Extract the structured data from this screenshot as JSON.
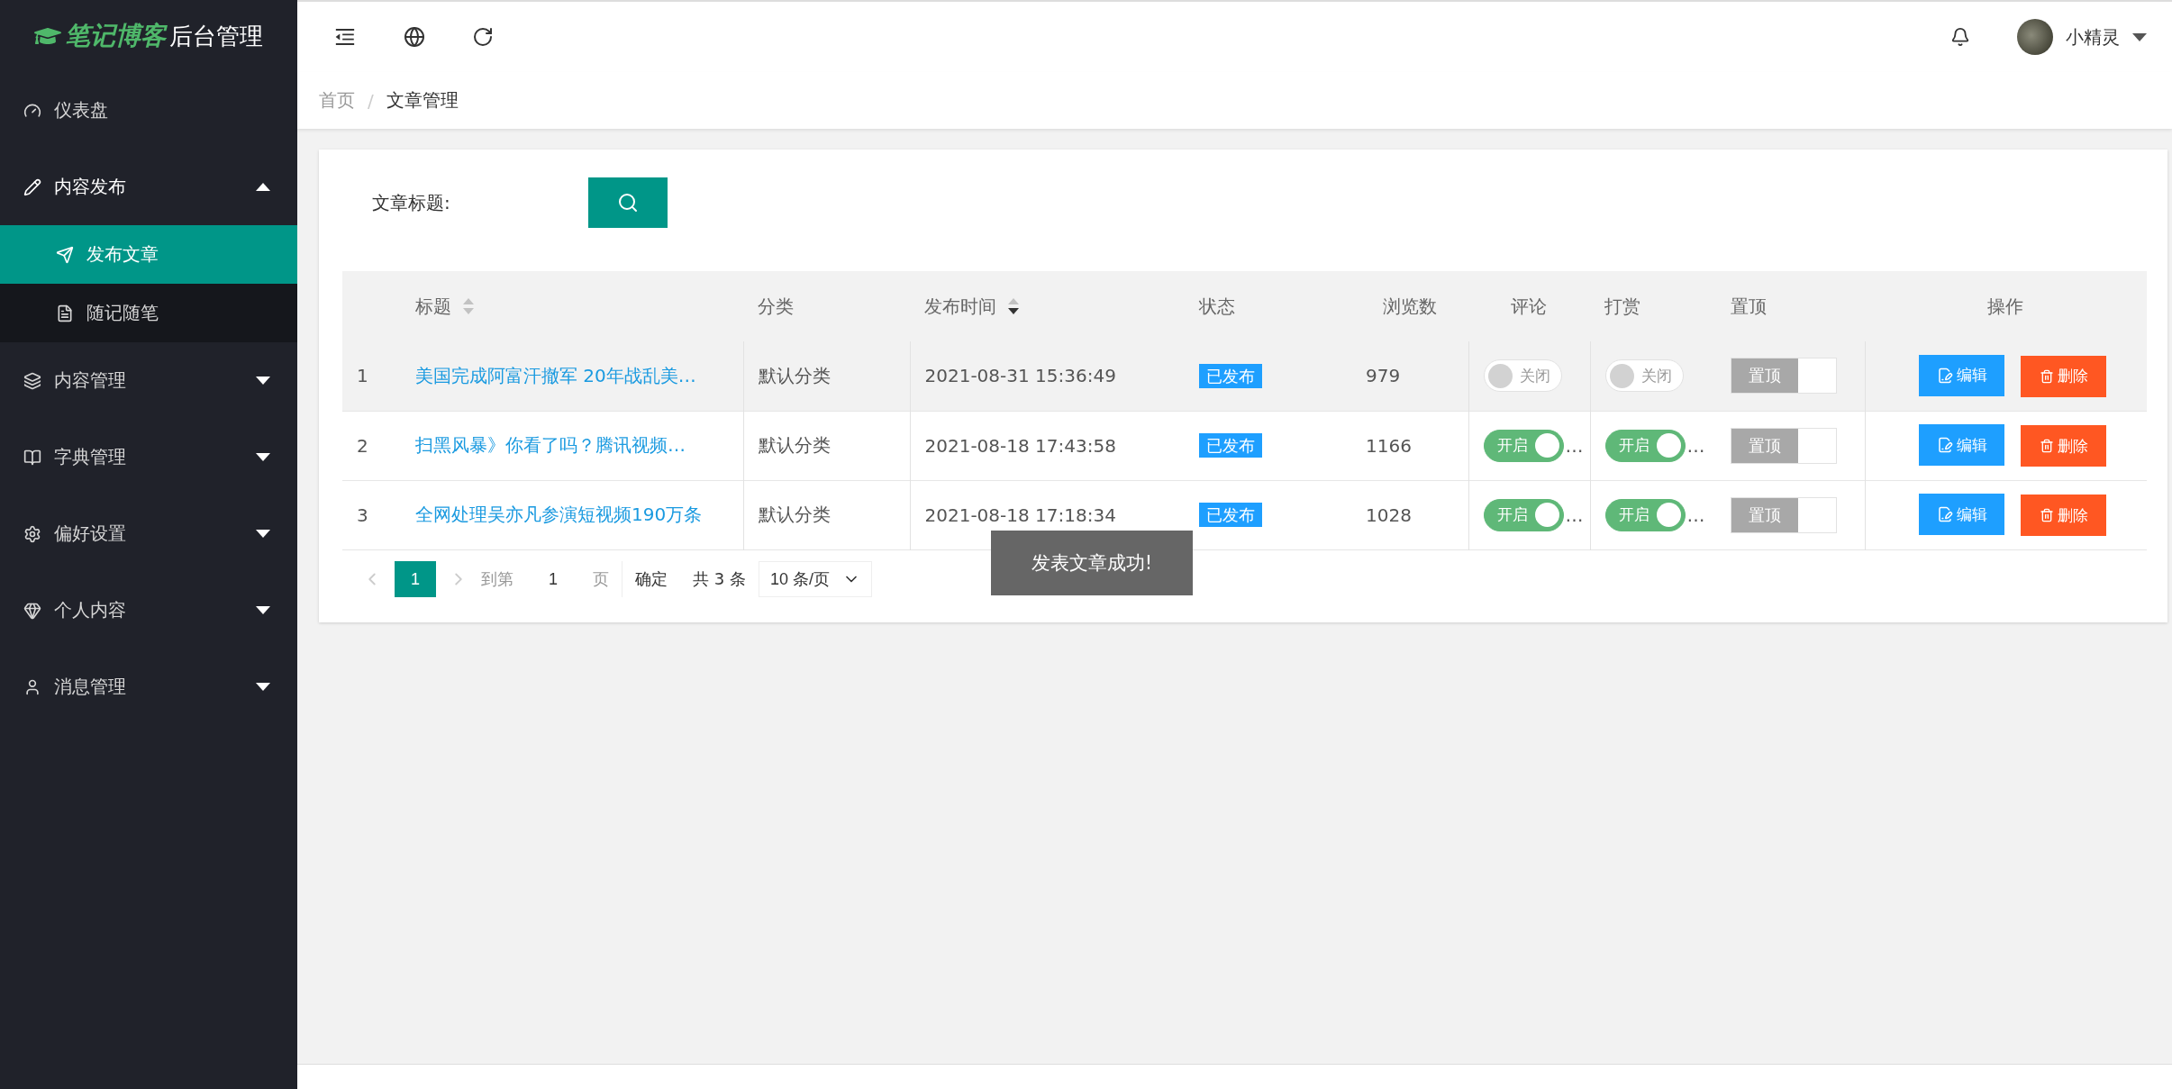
{
  "logo": {
    "brand": "笔记博客",
    "suffix": "后台管理"
  },
  "sidebar": {
    "items": [
      {
        "label": "仪表盘",
        "selected": false
      },
      {
        "label": "内容发布",
        "selected": false,
        "expanded": true,
        "children": [
          {
            "label": "发布文章",
            "selected": true
          },
          {
            "label": "随记随笔",
            "selected": false
          }
        ]
      },
      {
        "label": "内容管理",
        "selected": false,
        "expanded": false
      },
      {
        "label": "字典管理",
        "selected": false,
        "expanded": false
      },
      {
        "label": "偏好设置",
        "selected": false,
        "expanded": false
      },
      {
        "label": "个人内容",
        "selected": false,
        "expanded": false
      },
      {
        "label": "消息管理",
        "selected": false,
        "expanded": false
      }
    ]
  },
  "header": {
    "user": "小精灵"
  },
  "breadcrumb": {
    "items": [
      "首页",
      "文章管理"
    ],
    "separator": "/"
  },
  "search": {
    "label": "文章标题:"
  },
  "table": {
    "columns": [
      {
        "label": "标题",
        "sortable": true,
        "sort_active": false
      },
      {
        "label": "分类"
      },
      {
        "label": "发布时间",
        "sortable": true,
        "sort_active": true
      },
      {
        "label": "状态"
      },
      {
        "label": "浏览数"
      },
      {
        "label": "评论"
      },
      {
        "label": "打赏"
      },
      {
        "label": "置顶"
      },
      {
        "label": "操作"
      }
    ],
    "rows": [
      {
        "index": "1",
        "title": "美国完成阿富汗撤军 20年战乱美…",
        "category": "默认分类",
        "time": "2021-08-31 15:36:49",
        "status": "已发布",
        "views": "979",
        "comment": {
          "label": "关闭",
          "on": false
        },
        "reward": {
          "label": "关闭",
          "on": false
        },
        "pinned": {
          "label": "置顶",
          "on": false
        },
        "actions": [
          {
            "kind": "edit",
            "label": "编辑"
          },
          {
            "kind": "delete",
            "label": "删除"
          }
        ],
        "selected": true
      },
      {
        "index": "2",
        "title": "扫黑风暴》你看了吗？腾讯视频…",
        "category": "默认分类",
        "time": "2021-08-18 17:43:58",
        "status": "已发布",
        "views": "1166",
        "comment": {
          "label": "开启",
          "on": true,
          "overflow": "…"
        },
        "reward": {
          "label": "开启",
          "on": true,
          "overflow": "…"
        },
        "pinned": {
          "label": "置顶",
          "on": false
        },
        "actions": [
          {
            "kind": "edit",
            "label": "编辑"
          },
          {
            "kind": "delete",
            "label": "删除"
          }
        ],
        "selected": false
      },
      {
        "index": "3",
        "title": "全网处理吴亦凡参演短视频190万条",
        "category": "默认分类",
        "time": "2021-08-18 17:18:34",
        "status": "已发布",
        "views": "1028",
        "comment": {
          "label": "开启",
          "on": true,
          "overflow": "…"
        },
        "reward": {
          "label": "开启",
          "on": true,
          "overflow": "…"
        },
        "pinned": {
          "label": "置顶",
          "on": false
        },
        "actions": [
          {
            "kind": "edit",
            "label": "编辑"
          },
          {
            "kind": "delete",
            "label": "删除"
          }
        ],
        "selected": false
      }
    ]
  },
  "pagination": {
    "pages": [
      {
        "label": "1",
        "selected": true
      }
    ],
    "goto_label": "到第",
    "goto_value": "1",
    "page_unit": "页",
    "confirm": "确定",
    "total": "共 3 条",
    "page_size": "10 条/页"
  },
  "toast": "发表文章成功!"
}
